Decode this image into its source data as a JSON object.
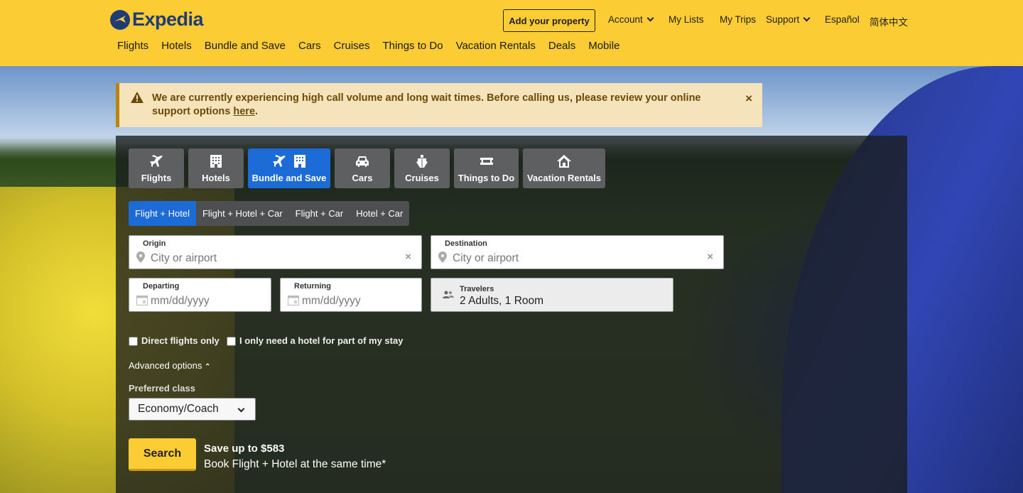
{
  "header": {
    "logo_text": "Expedia",
    "add_property": "Add your property",
    "account": "Account",
    "my_lists": "My Lists",
    "my_trips": "My Trips",
    "support": "Support",
    "espanol": "Español",
    "chinese": "简体中文",
    "nav": [
      "Flights",
      "Hotels",
      "Bundle and Save",
      "Cars",
      "Cruises",
      "Things to Do",
      "Vacation Rentals",
      "Deals",
      "Mobile"
    ]
  },
  "alert": {
    "text_before": "We are currently experiencing high call volume and long wait times.  Before calling us, please review your online support options ",
    "link": "here",
    "text_after": ".",
    "close": "×"
  },
  "tabs": [
    {
      "label": "Flights",
      "icon": "plane-icon"
    },
    {
      "label": "Hotels",
      "icon": "building-icon"
    },
    {
      "label": "Bundle and Save",
      "icon": "plane-building-icon"
    },
    {
      "label": "Cars",
      "icon": "car-icon"
    },
    {
      "label": "Cruises",
      "icon": "ship-icon"
    },
    {
      "label": "Things to Do",
      "icon": "ticket-icon"
    },
    {
      "label": "Vacation Rentals",
      "icon": "house-icon"
    }
  ],
  "subtabs": [
    "Flight + Hotel",
    "Flight + Hotel + Car",
    "Flight + Car",
    "Hotel + Car"
  ],
  "form": {
    "origin_label": "Origin",
    "origin_placeholder": "City or airport",
    "destination_label": "Destination",
    "destination_placeholder": "City or airport",
    "departing_label": "Departing",
    "departing_placeholder": "mm/dd/yyyy",
    "returning_label": "Returning",
    "returning_placeholder": "mm/dd/yyyy",
    "travelers_label": "Travelers",
    "travelers_value": "2 Adults, 1 Room",
    "direct_flights": "Direct flights only",
    "partial_hotel": "I only need a hotel for part of my stay",
    "advanced": "Advanced options",
    "preferred_class_label": "Preferred class",
    "preferred_class_value": "Economy/Coach",
    "search": "Search",
    "save_title": "Save up to $583",
    "save_sub": "Book Flight + Hotel at the same time*"
  },
  "colors": {
    "brand_yellow": "#fbcc33",
    "brand_blue": "#1f3c76",
    "active_blue": "#1c6bd6"
  }
}
